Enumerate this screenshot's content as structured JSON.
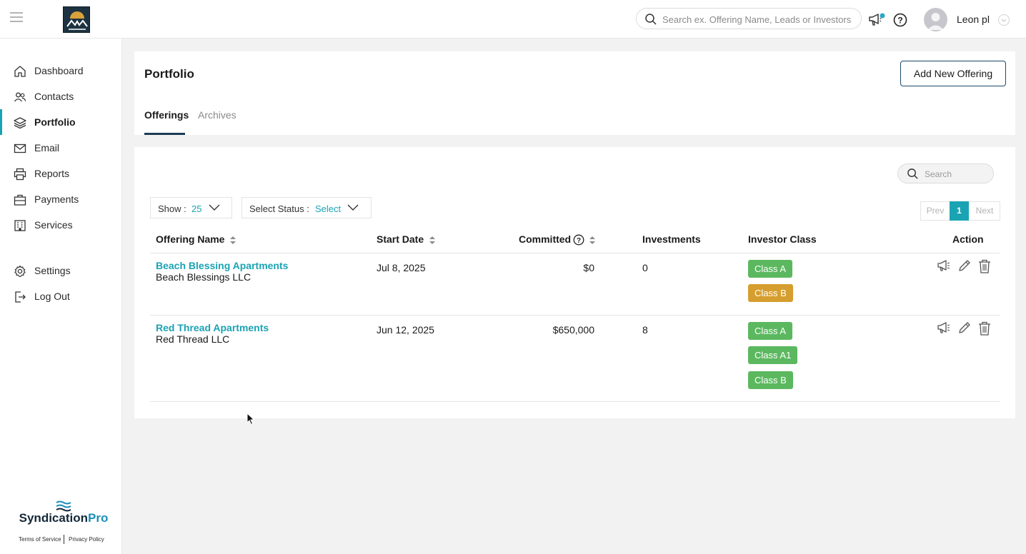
{
  "topbar": {
    "search_placeholder": "Search ex. Offering Name, Leads or Investors",
    "user_name": "Leon pl"
  },
  "sidebar": {
    "items": [
      {
        "label": "Dashboard",
        "icon": "home-icon"
      },
      {
        "label": "Contacts",
        "icon": "contacts-icon"
      },
      {
        "label": "Portfolio",
        "icon": "layers-icon",
        "active": true
      },
      {
        "label": "Email",
        "icon": "mail-icon"
      },
      {
        "label": "Reports",
        "icon": "printer-icon"
      },
      {
        "label": "Payments",
        "icon": "briefcase-icon"
      },
      {
        "label": "Services",
        "icon": "building-icon"
      },
      {
        "label": "Settings",
        "icon": "gear-icon"
      },
      {
        "label": "Log Out",
        "icon": "logout-icon"
      }
    ],
    "brand_name_main": "Syndication",
    "brand_name_accent": "Pro",
    "terms": "Terms of Service",
    "privacy": "Privacy Policy"
  },
  "header": {
    "title": "Portfolio",
    "add_button": "Add New Offering",
    "tabs": [
      "Offerings",
      "Archives"
    ]
  },
  "filters": {
    "search_placeholder": "Search",
    "show_label": "Show :",
    "show_value": "25",
    "status_label": "Select Status :",
    "status_value": "Select"
  },
  "pagination": {
    "prev": "Prev",
    "current": "1",
    "next": "Next"
  },
  "table": {
    "columns": [
      "Offering Name",
      "Start Date",
      "Committed",
      "Investments",
      "Investor Class",
      "Action"
    ],
    "rows": [
      {
        "name": "Beach Blessing Apartments",
        "company": "Beach Blessings LLC",
        "start_date": "Jul 8, 2025",
        "committed": "$0",
        "investments": "0",
        "classes": [
          {
            "label": "Class A",
            "color": "#5bb85f"
          },
          {
            "label": "Class B",
            "color": "#d69e2e"
          }
        ]
      },
      {
        "name": "Red Thread Apartments",
        "company": "Red Thread LLC",
        "start_date": "Jun 12, 2025",
        "committed": "$650,000",
        "investments": "8",
        "classes": [
          {
            "label": "Class A",
            "color": "#5bb85f"
          },
          {
            "label": "Class A1",
            "color": "#5bb85f"
          },
          {
            "label": "Class B",
            "color": "#5bb85f"
          }
        ]
      }
    ]
  },
  "colors": {
    "accent": "#1aa3b3",
    "navy": "#1d3b54",
    "green": "#5bb85f",
    "gold": "#d69e2e"
  }
}
